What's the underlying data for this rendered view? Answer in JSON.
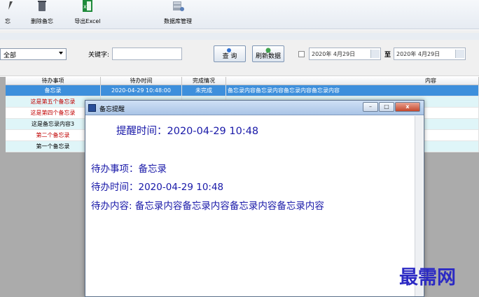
{
  "toolbar": {
    "partial_label": "忘",
    "delete_label": "删除备忘",
    "export_label": "导出Excel",
    "db_label": "数据库管理"
  },
  "filter": {
    "combo_value": "全部",
    "keyword_label": "关键字:",
    "query_label": "查 询",
    "refresh_label": "刷新数据",
    "date_from": "2020年 4月29日",
    "to_label": "至",
    "date_to": "2020年 4月29日"
  },
  "grid": {
    "headers": [
      "待办事项",
      "待办时间",
      "完成情况",
      "内容"
    ],
    "rows": [
      {
        "item": "备忘录",
        "time": "2020-04-29 10:48:00",
        "status": "未完成",
        "content": "备忘录内容备忘录内容备忘录内容备忘录内容"
      },
      {
        "item": "这是第五个备忘录",
        "time": "",
        "status": "",
        "content": ""
      },
      {
        "item": "这是第四个备忘录",
        "time": "",
        "status": "",
        "content": ""
      },
      {
        "item": "这是备忘录内容3",
        "time": "",
        "status": "",
        "content": ""
      },
      {
        "item": "第二个备忘录",
        "time": "",
        "status": "",
        "content": ""
      },
      {
        "item": "第一个备忘录",
        "time": "",
        "status": "",
        "content": ""
      }
    ]
  },
  "dialog": {
    "title": "备忘提醒",
    "remind_line": "提醒时间：2020-04-29 10:48",
    "item_line": "待办事项：备忘录",
    "time_line": "待办时间：2020-04-29 10:48",
    "content_line": "待办内容: 备忘录内容备忘录内容备忘录内容备忘录内容",
    "min_btn": "–",
    "max_btn": "□",
    "close_btn": "x"
  },
  "watermark": "最需网",
  "colors": {
    "selected_row": "#3d8fdc",
    "alt_row": "#dff5f8",
    "red_text": "#c00000",
    "dialog_text": "#1818a8",
    "grid_bg": "#ababab"
  }
}
